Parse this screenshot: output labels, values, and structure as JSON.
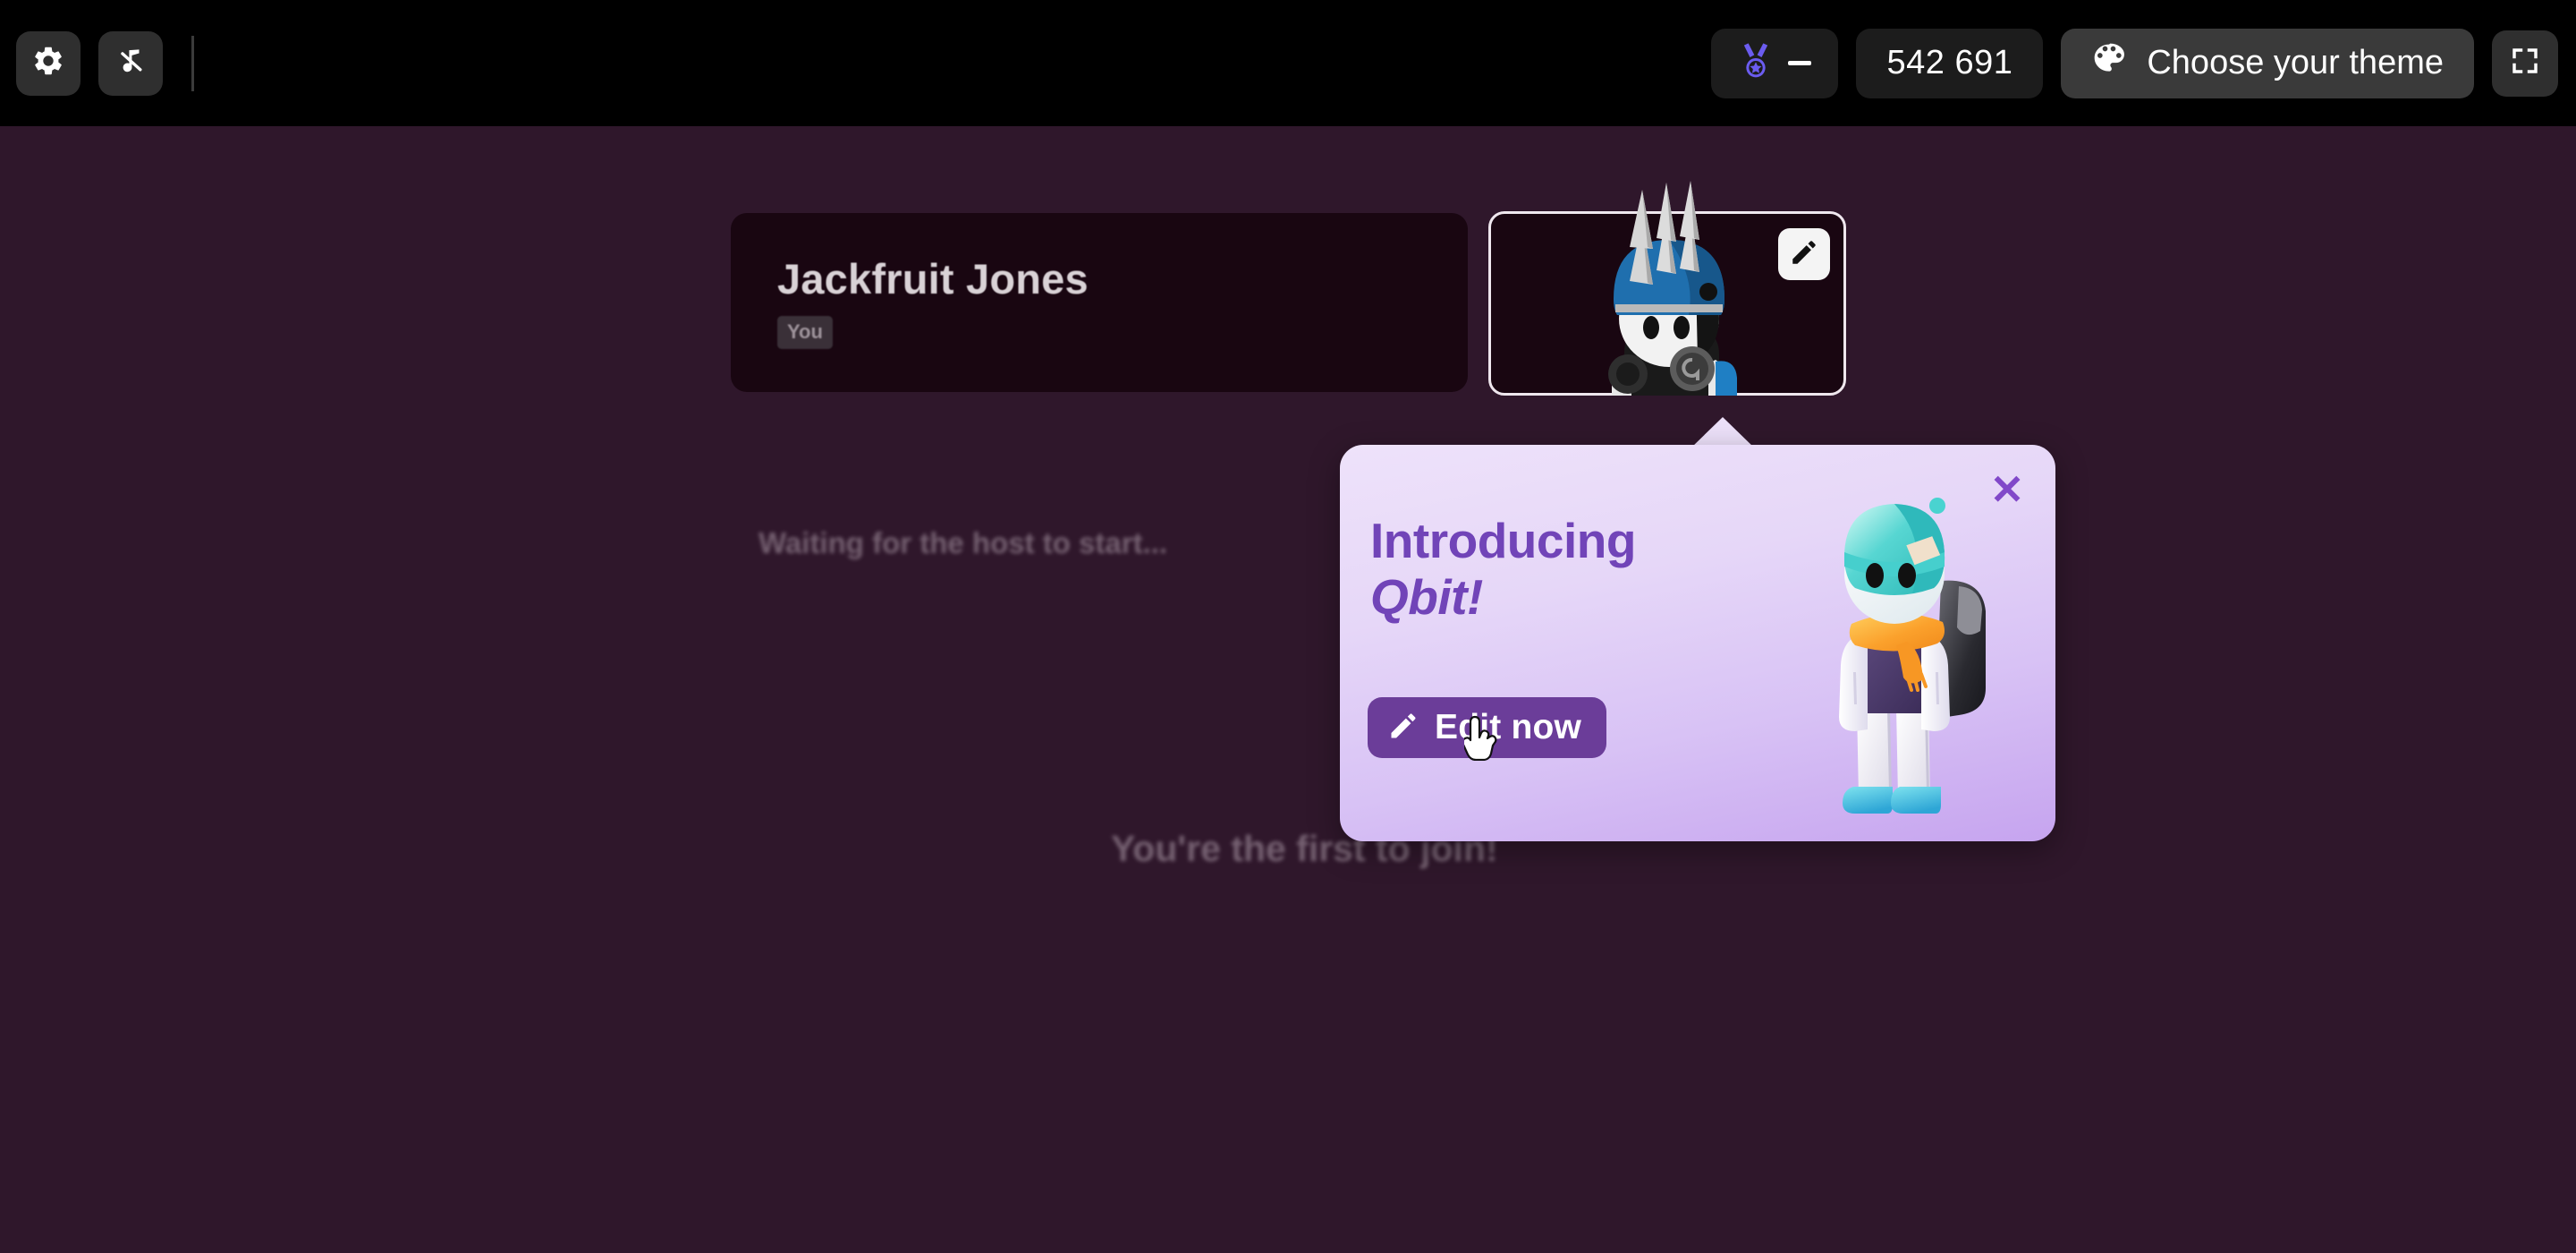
{
  "topbar": {
    "settings_icon": "gear-icon",
    "music_muted_icon": "music-note-muted-icon",
    "rank": {
      "icon": "medal-icon",
      "value": "—"
    },
    "room_code": "542 691",
    "theme": {
      "icon": "palette-icon",
      "label": "Choose your theme"
    },
    "fullscreen_icon": "fullscreen-icon"
  },
  "player": {
    "name": "Jackfruit Jones",
    "you_badge": "You",
    "avatar_alt": "blue-spiked-helmet-character",
    "edit_icon": "pencil-icon"
  },
  "lobby": {
    "waiting": "Waiting for the host to start...",
    "first_to_join": "You're the first to join!"
  },
  "popup": {
    "title_line1": "Introducing",
    "title_line2": "Qbit!",
    "cta_label": "Edit now",
    "cta_icon": "pencil-icon",
    "close_icon": "close-x-icon",
    "character_alt": "qbit-character-teal-beanie"
  },
  "colors": {
    "page_background": "#2f172b",
    "topbar_background": "#000000",
    "card_background": "#190611",
    "popup_gradient_start": "#eee2fa",
    "popup_gradient_end": "#c6a4ef",
    "popup_title": "#7144b8",
    "cta_button": "#6b3d99",
    "medal_accent": "#6b5cf0",
    "close_x": "#8148c9"
  }
}
